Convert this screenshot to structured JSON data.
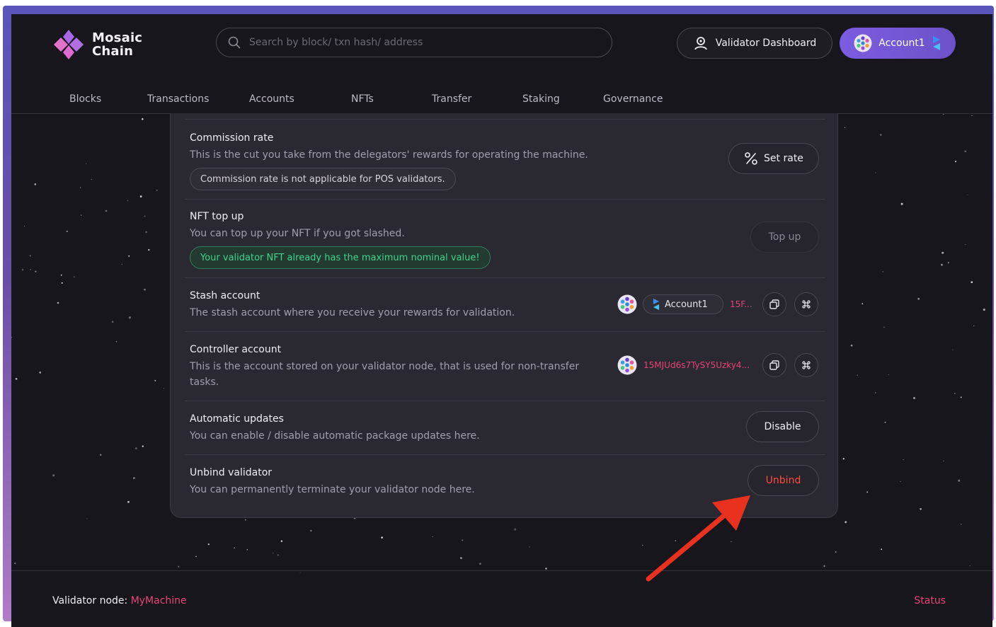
{
  "header": {
    "logo_line1": "Mosaic",
    "logo_line2": "Chain",
    "search_placeholder": "Search by block/ txn hash/ address",
    "validator_dashboard_label": "Validator Dashboard",
    "account_label": "Account1"
  },
  "nav": {
    "items": [
      "Blocks",
      "Transactions",
      "Accounts",
      "NFTs",
      "Transfer",
      "Staking",
      "Governance"
    ]
  },
  "settings": {
    "commission": {
      "title": "Commission rate",
      "desc": "This is the cut you take from the delegators' rewards for operating the machine.",
      "note": "Commission rate is not applicable for POS validators.",
      "button": "Set rate"
    },
    "nft_topup": {
      "title": "NFT top up",
      "desc": "You can top up your NFT if you got slashed.",
      "note": "Your validator NFT already has the maximum nominal value!",
      "button": "Top up"
    },
    "stash": {
      "title": "Stash account",
      "desc": "The stash account where you receive your rewards for validation.",
      "account_name": "Account1",
      "address": "15F..."
    },
    "controller": {
      "title": "Controller account",
      "desc_line1": "This is the account stored on your validator node, that is used for non-transfer",
      "desc_line2": "tasks.",
      "address": "15MJUd6s7TySY5Uzky4..."
    },
    "auto_updates": {
      "title": "Automatic updates",
      "desc": "You can enable / disable automatic package updates here.",
      "button": "Disable"
    },
    "unbind": {
      "title": "Unbind validator",
      "desc": "You can permanently terminate your validator node here.",
      "button": "Unbind"
    }
  },
  "footer": {
    "node_label": "Validator node:",
    "node_value": "MyMachine",
    "status": "Status"
  },
  "colors": {
    "accent_purple": "#7b5ce0",
    "danger": "#ff4b3e",
    "pink": "#e8447a",
    "success": "#3fd38c",
    "annotation_arrow": "#e8321f"
  },
  "icons": [
    "logo-icon",
    "search-icon",
    "validator-icon",
    "avatar-icon",
    "brand-s-icon",
    "percent-icon",
    "copy-icon",
    "command-icon"
  ]
}
